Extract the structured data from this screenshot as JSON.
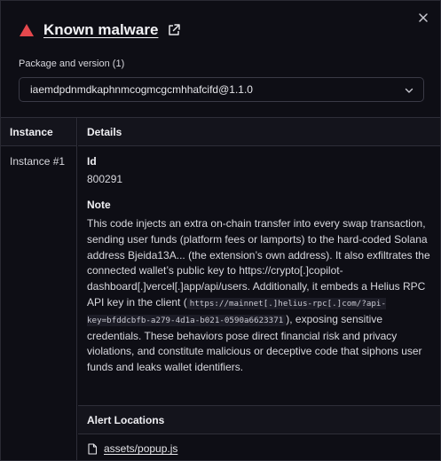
{
  "alert": {
    "title": "Known malware"
  },
  "package": {
    "label": "Package and version",
    "count": "(1)",
    "selected": "iaemdpdnmdkaphnmcogmcgcmhhafcifd@1.1.0"
  },
  "table": {
    "instance_header": "Instance",
    "details_header": "Details",
    "instances": [
      "Instance #1"
    ]
  },
  "details": {
    "id_label": "Id",
    "id_value": "800291",
    "note_label": "Note",
    "note_part1": "This code injects an extra on-chain transfer into every swap transaction, sending user funds (platform fees or lamports) to the hard-coded Solana address Bjeida13A... (the extension’s own address). It also exfiltrates the connected wallet’s public key to https://crypto[.]copilot-dashboard[.]vercel[.]app/api/users. Additionally, it embeds a Helius RPC API key in the client (",
    "note_code": "https://mainnet[.]helius-rpc[.]com/?api-key=bfddcbfb-a279-4d1a-b021-0590a6623371",
    "note_part2": "), exposing sensitive credentials. These behaviors pose direct financial risk and privacy violations, and constitute malicious or deceptive code that siphons user funds and leaks wallet identifiers."
  },
  "alert_locations": {
    "header": "Alert Locations",
    "files": [
      "assets/popup.js"
    ]
  },
  "colors": {
    "warning": "#e5484d",
    "background": "#0e0e15",
    "border": "#2e2e38"
  }
}
